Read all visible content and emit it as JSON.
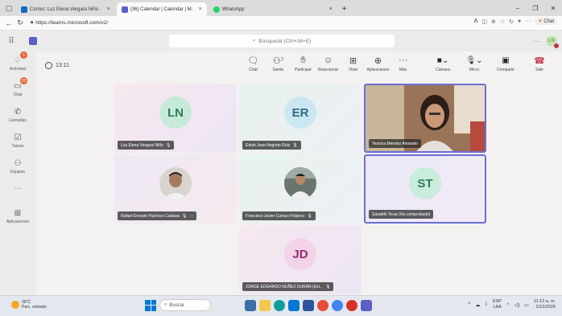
{
  "browser": {
    "tabs": [
      {
        "label": "Correo: Luz Elena Vergara Niño ·",
        "color": "#0f6cbd",
        "active": false
      },
      {
        "label": "(36) Calendar | Calendar | M·",
        "color": "#5b5fc7",
        "active": true
      },
      {
        "label": "WhatsApp",
        "color": "#25d366",
        "active": false
      }
    ],
    "new_tab": "+",
    "url": "https://teams.microsoft.com/v2/",
    "copilot_label": "Chat"
  },
  "teams": {
    "search_placeholder": "Búsqueda (Ctrl+Alt+E)",
    "user_initials": "LN",
    "more": "···",
    "rail": [
      {
        "label": "Actividad",
        "badge": "5"
      },
      {
        "label": "Chat",
        "badge": "20"
      },
      {
        "label": "Llamadas",
        "badge": ""
      },
      {
        "label": "Tareas",
        "badge": ""
      },
      {
        "label": "Equipos",
        "badge": ""
      },
      {
        "label": "···",
        "badge": ""
      },
      {
        "label": "Aplicaciones",
        "badge": ""
      }
    ]
  },
  "meeting": {
    "timer": "13:11",
    "controls": [
      {
        "label": "Chat",
        "icon": "chat-icon"
      },
      {
        "label": "Gente",
        "icon": "people-icon",
        "count": "7"
      },
      {
        "label": "Participar",
        "icon": "raise-hand-icon"
      },
      {
        "label": "Reaccionar",
        "icon": "react-icon"
      },
      {
        "label": "Vista",
        "icon": "view-icon"
      },
      {
        "label": "Aplicaciones",
        "icon": "apps-icon"
      },
      {
        "label": "Más",
        "icon": "more-icon"
      }
    ],
    "camera_label": "Cámara",
    "mic_label": "Micro",
    "share_label": "Compartir",
    "leave_label": "Salir",
    "participants": [
      {
        "name": "Luz Elena Vergara Niño",
        "initials": "LN"
      },
      {
        "name": "Eduin Jose Negrete Ruiz",
        "initials": "ER"
      },
      {
        "name": "Yessica Mendez Alvarado",
        "initials": ""
      },
      {
        "name": "Rafael Ernesto Pacheco Cabana",
        "initials": ""
      },
      {
        "name": "Francisco Javier Campo Polanco",
        "initials": ""
      },
      {
        "name": "Saradith Tovar (No comprobado)",
        "initials": "ST"
      },
      {
        "name": "JORGE EDGARDO NUÑEZ DURAN (Ext...",
        "initials": "JD"
      }
    ]
  },
  "taskbar": {
    "temp": "30°C",
    "weather": "Parc. soleado",
    "search": "Buscar",
    "lang_top": "ESP",
    "lang_bottom": "LAA",
    "time": "11:13 a. m.",
    "date": "2/12/2025"
  }
}
